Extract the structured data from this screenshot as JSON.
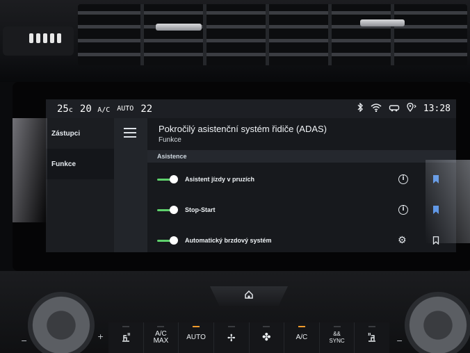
{
  "status_bar": {
    "temp_left": "25",
    "temp_unit": "c",
    "fan_speed": "20",
    "ac_label": "A/C",
    "auto_label": "AUTO",
    "temp_right": "22",
    "time": "13:28",
    "icons": [
      "bluetooth-icon",
      "wifi-icon",
      "car-connect-icon",
      "location-icon"
    ]
  },
  "sidebar": {
    "items": [
      {
        "label": "Zástupci",
        "active": false
      },
      {
        "label": "Funkce",
        "active": true
      }
    ]
  },
  "header": {
    "title": "Pokročilý asistenční systém řidiče (ADAS)",
    "subtitle": "Funkce"
  },
  "section": {
    "label": "Asistence"
  },
  "rows": [
    {
      "label": "Asistent jízdy v pruzích",
      "enabled": true,
      "action_icon": "info-icon",
      "bookmark": "filled"
    },
    {
      "label": "Stop-Start",
      "enabled": true,
      "action_icon": "info-icon",
      "bookmark": "filled"
    },
    {
      "label": "Automatický brzdový systém",
      "enabled": true,
      "action_icon": "gear-icon",
      "bookmark": "outline"
    }
  ],
  "console": {
    "buttons": [
      {
        "label": "",
        "icon": "seat-heat-icon"
      },
      {
        "label": "A/C\nMAX",
        "icon": ""
      },
      {
        "label": "AUTO",
        "icon": ""
      },
      {
        "label": "",
        "icon": "fan-icon"
      },
      {
        "label": "",
        "icon": "fan-high-icon"
      },
      {
        "label": "A/C",
        "icon": ""
      },
      {
        "label": "SYNC",
        "icon": "sync-icon"
      },
      {
        "label": "",
        "icon": "seat-heat-right-icon"
      }
    ]
  },
  "colors": {
    "toggle_on": "#5ed16c",
    "bookmark_blue": "#4f8fe8",
    "indicator_led": "#f29b2c"
  }
}
